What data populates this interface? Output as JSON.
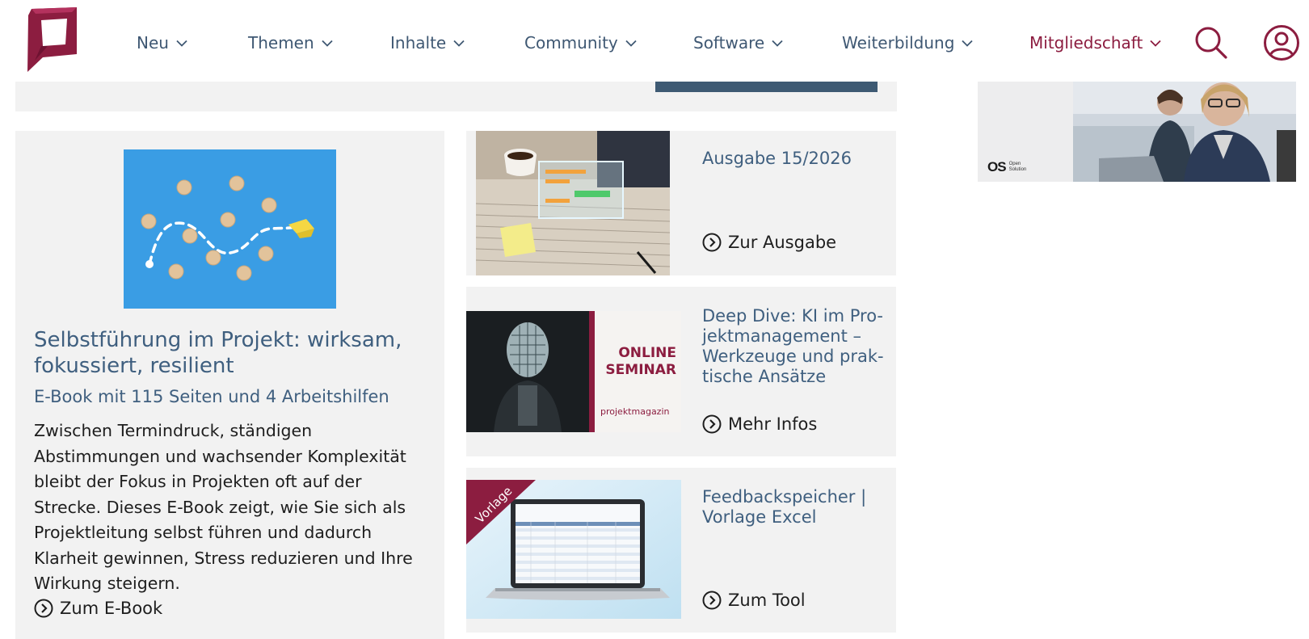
{
  "header": {
    "nav": [
      {
        "label": "Neu"
      },
      {
        "label": "Themen"
      },
      {
        "label": "Inhalte"
      },
      {
        "label": "Community"
      },
      {
        "label": "Software"
      },
      {
        "label": "Weiterbildung"
      },
      {
        "label": "Mitgliedschaft"
      }
    ]
  },
  "ad": {
    "logo_mark": "OS",
    "logo_text_1": "Open",
    "logo_text_2": "Solution"
  },
  "ebook": {
    "title": "Selbstführung im Projekt: wirksam, fokussiert, resilient",
    "subtitle": "E-Book mit 115 Seiten und 4 Arbeitshilfen",
    "body": "Zwischen Termindruck, ständigen Abstimmungen und wachsender Komplexität bleibt der Fokus in Projekten oft auf der Strecke. Dieses E-Book zeigt, wie Sie sich als Projektleitung selbst führen und dadurch Klarheit gewinnen, Stress reduzieren und Ihre Wirkung steigern.",
    "link": "Zum E-Book"
  },
  "issue": {
    "title": "Ausgabe 15/2026",
    "link": "Zur Ausgabe"
  },
  "seminar": {
    "badge_line1": "ONLINE",
    "badge_line2": "SEMINAR",
    "brand": "projektmagazin",
    "title": "Deep Dive: KI im Pro-jektmanagement – Werkzeuge und prak-tische Ansätze",
    "link": "Mehr Infos"
  },
  "template": {
    "ribbon": "Vorlage",
    "title": "Feedbackspeicher | Vorlage Excel",
    "link": "Zum Tool"
  },
  "colors": {
    "brand": "#8c1d40",
    "nav": "#3f5873",
    "heading": "#3f5f7f",
    "card_bg": "#f2f2f2"
  }
}
